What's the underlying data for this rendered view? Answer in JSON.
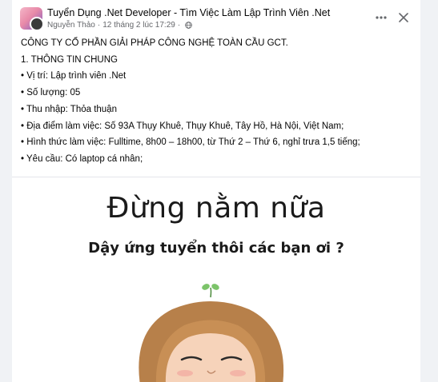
{
  "post": {
    "group_name": "Tuyển Dụng .Net Developer - Tìm Việc Làm Lập Trình Viên .Net",
    "author": "Nguyễn Thảo",
    "separator": "·",
    "timestamp": "12 tháng 2 lúc 17:29",
    "dot": "·",
    "more_icon": "more-horizontal-icon",
    "close_icon": "close-icon",
    "privacy_icon": "globe-icon",
    "lines": [
      "CÔNG TY CỔ PHẦN GIẢI PHÁP CÔNG NGHỆ TOÀN CẦU GCT.",
      "1. THÔNG TIN CHUNG",
      "• Vị trí: Lập trình viên .Net",
      "• Số lượng: 05",
      "• Thu nhập: Thỏa thuận",
      "• Địa điểm làm việc: Số 93A Thụy Khuê, Thụy Khuê, Tây Hồ, Hà Nội, Việt Nam;",
      "• Hình thức làm việc: Fulltime, 8h00 – 18h00, từ Thứ 2 – Thứ 6, nghỉ trưa 1,5 tiếng;",
      "• Yêu cầu: Có laptop cá nhân;"
    ]
  },
  "image": {
    "headline": "Đừng nằm nữa",
    "subline": "Dậy ứng tuyển thôi các bạn ơi ?"
  },
  "colors": {
    "page_bg": "#f0f2f5",
    "card_bg": "#ffffff",
    "text_primary": "#050505",
    "text_secondary": "#65676b"
  }
}
